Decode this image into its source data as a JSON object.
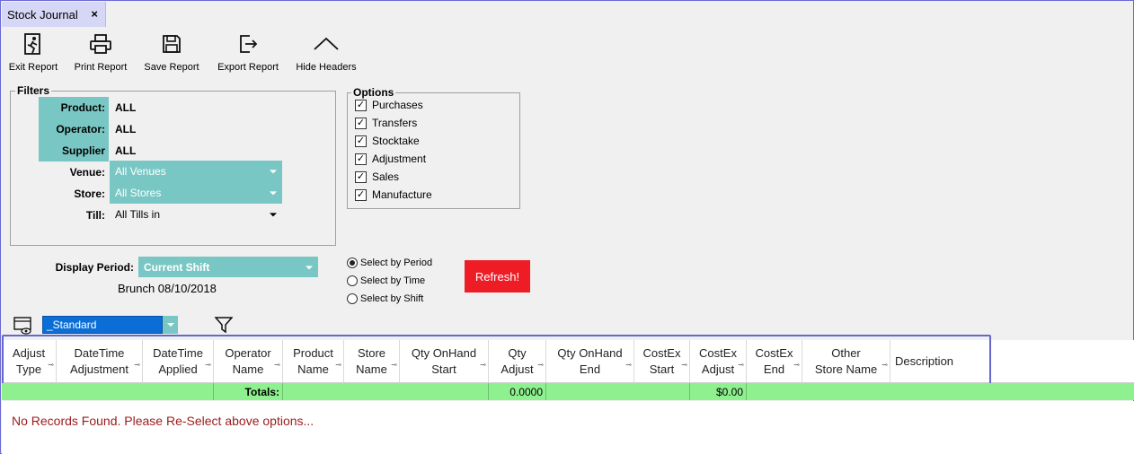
{
  "tab": {
    "title": "Stock Journal",
    "close": "×"
  },
  "toolbar": {
    "exit": "Exit Report",
    "print": "Print Report",
    "save": "Save Report",
    "export": "Export Report",
    "hide": "Hide Headers"
  },
  "filters": {
    "title": "Filters",
    "product_label": "Product:",
    "product_value": "ALL",
    "operator_label": "Operator:",
    "operator_value": "ALL",
    "supplier_label": "Supplier",
    "supplier_value": "ALL",
    "venue_label": "Venue:",
    "venue_value": "All Venues",
    "store_label": "Store:",
    "store_value": "All Stores",
    "till_label": "Till:",
    "till_value": "All Tills in"
  },
  "options": {
    "title": "Options",
    "items": [
      {
        "label": "Purchases",
        "checked": true
      },
      {
        "label": "Transfers",
        "checked": true
      },
      {
        "label": "Stocktake",
        "checked": true
      },
      {
        "label": "Adjustment",
        "checked": true
      },
      {
        "label": "Sales",
        "checked": true
      },
      {
        "label": "Manufacture",
        "checked": true
      }
    ]
  },
  "period": {
    "label": "Display Period:",
    "value": "Current Shift",
    "shift_info": "Brunch 08/10/2018",
    "radio_period": "Select by Period",
    "radio_time": "Select  by Time",
    "radio_shift": "Select by Shift",
    "selected": "period"
  },
  "refresh_label": "Refresh!",
  "layout": {
    "value": "_Standard"
  },
  "grid": {
    "columns": [
      {
        "l1": "Adjust",
        "l2": "Type"
      },
      {
        "l1": "DateTime",
        "l2": "Adjustment"
      },
      {
        "l1": "DateTime",
        "l2": "Applied"
      },
      {
        "l1": "Operator",
        "l2": "Name"
      },
      {
        "l1": "Product",
        "l2": "Name"
      },
      {
        "l1": "Store",
        "l2": "Name"
      },
      {
        "l1": "Qty OnHand",
        "l2": "Start"
      },
      {
        "l1": "Qty",
        "l2": "Adjust"
      },
      {
        "l1": "Qty OnHand",
        "l2": "End"
      },
      {
        "l1": "CostEx",
        "l2": "Start"
      },
      {
        "l1": "CostEx",
        "l2": "Adjust"
      },
      {
        "l1": "CostEx",
        "l2": "End"
      },
      {
        "l1": "Other",
        "l2": "Store Name"
      },
      {
        "l1": "Description",
        "l2": ""
      }
    ],
    "totals_label": "Totals:",
    "qty_adjust_total": "0.0000",
    "costex_adjust_total": "$0.00",
    "no_records": "No Records Found. Please Re-Select above options..."
  },
  "colors": {
    "teal": "#79c7c4",
    "refresh": "#ee1c25",
    "totals": "#8ef08e",
    "tab": "#d6d6f6"
  }
}
